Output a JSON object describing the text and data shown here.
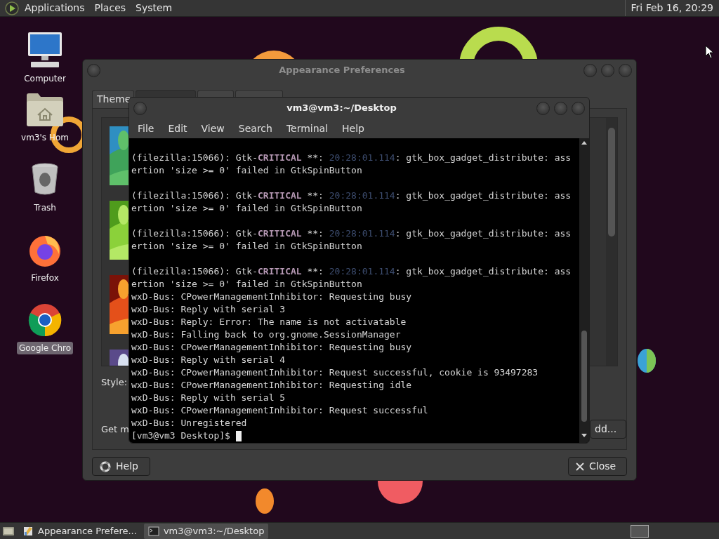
{
  "top_panel": {
    "menus": [
      "Applications",
      "Places",
      "System"
    ],
    "clock": "Fri Feb 16, 20:29"
  },
  "desktop_icons": [
    {
      "kind": "computer",
      "label": "Computer",
      "selected": false
    },
    {
      "kind": "home",
      "label": "vm3's Hom",
      "selected": false
    },
    {
      "kind": "trash",
      "label": "Trash",
      "selected": false
    },
    {
      "kind": "firefox",
      "label": "Firefox",
      "selected": false
    },
    {
      "kind": "chrome",
      "label": "Google Chro",
      "selected": true
    }
  ],
  "appearance_window": {
    "title": "Appearance Preferences",
    "tabs": [
      {
        "label": "Theme",
        "selected": false
      },
      {
        "selected": true
      },
      {
        "selected": false
      },
      {
        "selected": false
      }
    ],
    "style_label": "Style:",
    "get_more_label": "Get m",
    "add_button": "dd...",
    "help_button": "Help",
    "close_button": "Close"
  },
  "terminal_window": {
    "title": "vm3@vm3:~/Desktop",
    "menus": [
      "File",
      "Edit",
      "View",
      "Search",
      "Terminal",
      "Help"
    ],
    "lines": [
      {
        "kind": "text",
        "segments": [
          {
            "kind": "plain",
            "text": "(filezilla:15066): Gtk-"
          },
          {
            "kind": "critical",
            "text": "CRITICAL"
          },
          {
            "kind": "plain",
            "text": " **: "
          },
          {
            "kind": "timestamp",
            "text": "20:28:01.114"
          },
          {
            "kind": "plain",
            "text": ": gtk_box_gadget_distribute: ass"
          }
        ]
      },
      {
        "kind": "text",
        "segments": [
          {
            "kind": "plain",
            "text": "ertion 'size >= 0' failed in GtkSpinButton"
          }
        ]
      },
      {
        "kind": "blank"
      },
      {
        "kind": "text",
        "segments": [
          {
            "kind": "plain",
            "text": "(filezilla:15066): Gtk-"
          },
          {
            "kind": "critical",
            "text": "CRITICAL"
          },
          {
            "kind": "plain",
            "text": " **: "
          },
          {
            "kind": "timestamp",
            "text": "20:28:01.114"
          },
          {
            "kind": "plain",
            "text": ": gtk_box_gadget_distribute: ass"
          }
        ]
      },
      {
        "kind": "text",
        "segments": [
          {
            "kind": "plain",
            "text": "ertion 'size >= 0' failed in GtkSpinButton"
          }
        ]
      },
      {
        "kind": "blank"
      },
      {
        "kind": "text",
        "segments": [
          {
            "kind": "plain",
            "text": "(filezilla:15066): Gtk-"
          },
          {
            "kind": "critical",
            "text": "CRITICAL"
          },
          {
            "kind": "plain",
            "text": " **: "
          },
          {
            "kind": "timestamp",
            "text": "20:28:01.114"
          },
          {
            "kind": "plain",
            "text": ": gtk_box_gadget_distribute: ass"
          }
        ]
      },
      {
        "kind": "text",
        "segments": [
          {
            "kind": "plain",
            "text": "ertion 'size >= 0' failed in GtkSpinButton"
          }
        ]
      },
      {
        "kind": "blank"
      },
      {
        "kind": "text",
        "segments": [
          {
            "kind": "plain",
            "text": "(filezilla:15066): Gtk-"
          },
          {
            "kind": "critical",
            "text": "CRITICAL"
          },
          {
            "kind": "plain",
            "text": " **: "
          },
          {
            "kind": "timestamp",
            "text": "20:28:01.114"
          },
          {
            "kind": "plain",
            "text": ": gtk_box_gadget_distribute: ass"
          }
        ]
      },
      {
        "kind": "text",
        "segments": [
          {
            "kind": "plain",
            "text": "ertion 'size >= 0' failed in GtkSpinButton"
          }
        ]
      },
      {
        "kind": "text",
        "segments": [
          {
            "kind": "plain",
            "text": "wxD-Bus: CPowerManagementInhibitor: Requesting busy"
          }
        ]
      },
      {
        "kind": "text",
        "segments": [
          {
            "kind": "plain",
            "text": "wxD-Bus: Reply with serial 3"
          }
        ]
      },
      {
        "kind": "text",
        "segments": [
          {
            "kind": "plain",
            "text": "wxD-Bus: Reply: Error: The name is not activatable"
          }
        ]
      },
      {
        "kind": "text",
        "segments": [
          {
            "kind": "plain",
            "text": "wxD-Bus: Falling back to org.gnome.SessionManager"
          }
        ]
      },
      {
        "kind": "text",
        "segments": [
          {
            "kind": "plain",
            "text": "wxD-Bus: CPowerManagementInhibitor: Requesting busy"
          }
        ]
      },
      {
        "kind": "text",
        "segments": [
          {
            "kind": "plain",
            "text": "wxD-Bus: Reply with serial 4"
          }
        ]
      },
      {
        "kind": "text",
        "segments": [
          {
            "kind": "plain",
            "text": "wxD-Bus: CPowerManagementInhibitor: Request successful, cookie is 93497283"
          }
        ]
      },
      {
        "kind": "text",
        "segments": [
          {
            "kind": "plain",
            "text": "wxD-Bus: CPowerManagementInhibitor: Requesting idle"
          }
        ]
      },
      {
        "kind": "text",
        "segments": [
          {
            "kind": "plain",
            "text": "wxD-Bus: Reply with serial 5"
          }
        ]
      },
      {
        "kind": "text",
        "segments": [
          {
            "kind": "plain",
            "text": "wxD-Bus: CPowerManagementInhibitor: Request successful"
          }
        ]
      },
      {
        "kind": "text",
        "segments": [
          {
            "kind": "plain",
            "text": "wxD-Bus: Unregistered"
          }
        ]
      },
      {
        "kind": "prompt",
        "text": "[vm3@vm3 Desktop]$"
      }
    ]
  },
  "taskbar": {
    "tasks": [
      {
        "kind": "appearance",
        "label": "Appearance Prefere...",
        "selected": false
      },
      {
        "kind": "terminal",
        "label": "vm3@vm3:~/Desktop",
        "selected": true
      }
    ]
  }
}
